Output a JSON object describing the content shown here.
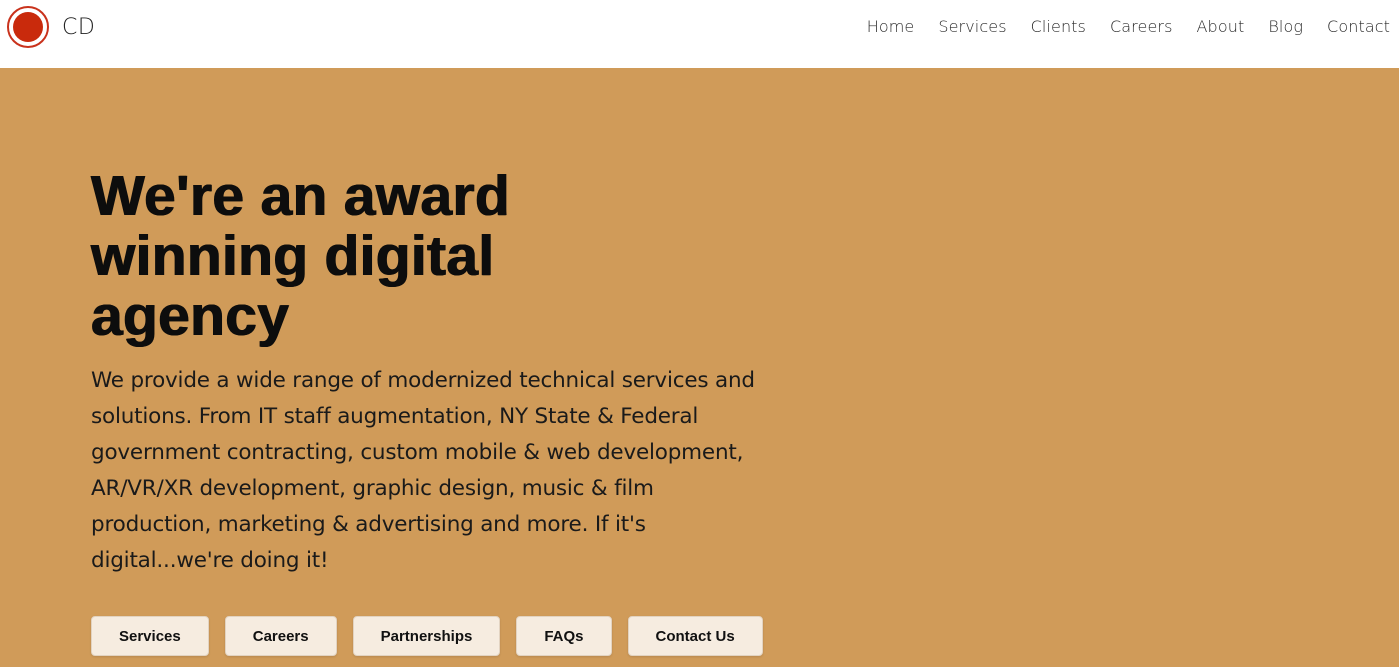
{
  "brand": {
    "logo_icon": "record-circle-icon",
    "text": "CD",
    "colors": {
      "logo_ring": "#c9321c",
      "logo_fill": "#c92a0c"
    }
  },
  "nav": {
    "items": [
      {
        "label": "Home"
      },
      {
        "label": "Services"
      },
      {
        "label": "Clients"
      },
      {
        "label": "Careers"
      },
      {
        "label": "About"
      },
      {
        "label": "Blog"
      },
      {
        "label": "Contact"
      }
    ]
  },
  "hero": {
    "title": "We're an award winning digital agency",
    "description": "We provide a wide range of modernized technical services and solutions. From IT staff augmentation, NY State & Federal government contracting, custom mobile & web development, AR/VR/XR development, graphic design, music & film production, marketing & advertising and more. If it's digital...we're doing it!",
    "background_color": "#d09b59"
  },
  "buttons": [
    {
      "label": "Services"
    },
    {
      "label": "Careers"
    },
    {
      "label": "Partnerships"
    },
    {
      "label": "FAQs"
    },
    {
      "label": "Contact Us"
    }
  ]
}
